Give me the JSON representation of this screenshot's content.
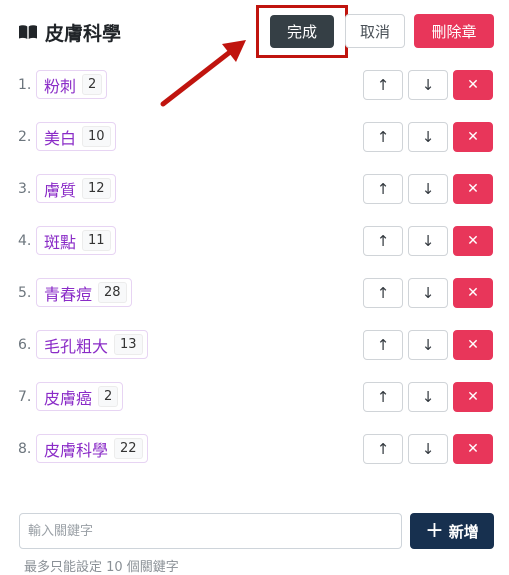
{
  "header": {
    "title": "皮膚科學",
    "icon": "book-icon"
  },
  "actions": {
    "done_label": "完成",
    "cancel_label": "取消",
    "delete_label": "刪除章"
  },
  "rows": [
    {
      "num": "1.",
      "label": "粉刺",
      "count": "2"
    },
    {
      "num": "2.",
      "label": "美白",
      "count": "10"
    },
    {
      "num": "3.",
      "label": "膚質",
      "count": "12"
    },
    {
      "num": "4.",
      "label": "斑點",
      "count": "11"
    },
    {
      "num": "5.",
      "label": "青春痘",
      "count": "28"
    },
    {
      "num": "6.",
      "label": "毛孔粗大",
      "count": "13"
    },
    {
      "num": "7.",
      "label": "皮膚癌",
      "count": "2"
    },
    {
      "num": "8.",
      "label": "皮膚科學",
      "count": "22"
    }
  ],
  "row_buttons": {
    "up_glyph": "↑",
    "down_glyph": "↓",
    "remove_glyph": "✕"
  },
  "add": {
    "placeholder": "輸入關鍵字",
    "button_label": "新增",
    "plus_glyph": "+"
  },
  "hint": "最多只能設定 10 個關鍵字",
  "colors": {
    "accent_red": "#e8365a",
    "done_dark": "#353f45",
    "add_navy": "#17304f",
    "tag_purple": "#8a2bc7",
    "annotation_red": "#c0140e"
  }
}
